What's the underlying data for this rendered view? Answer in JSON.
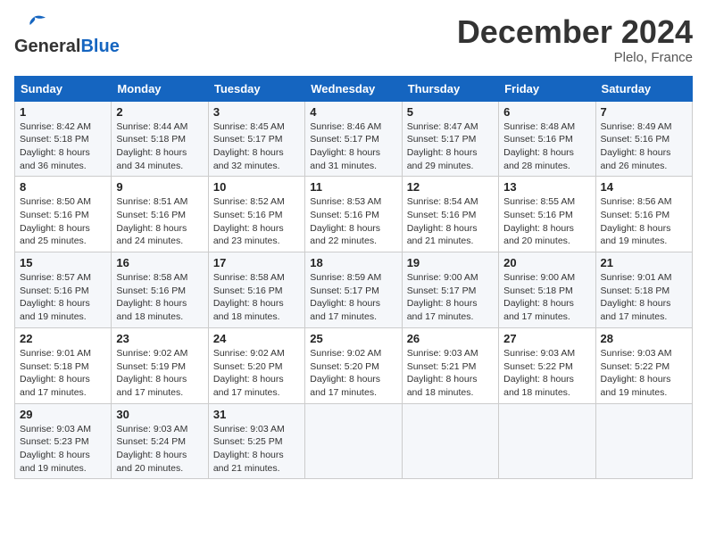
{
  "header": {
    "logo_general": "General",
    "logo_blue": "Blue",
    "month_title": "December 2024",
    "location": "Plelo, France"
  },
  "weekdays": [
    "Sunday",
    "Monday",
    "Tuesday",
    "Wednesday",
    "Thursday",
    "Friday",
    "Saturday"
  ],
  "weeks": [
    [
      {
        "day": "1",
        "sunrise": "8:42 AM",
        "sunset": "5:18 PM",
        "daylight": "8 hours and 36 minutes."
      },
      {
        "day": "2",
        "sunrise": "8:44 AM",
        "sunset": "5:18 PM",
        "daylight": "8 hours and 34 minutes."
      },
      {
        "day": "3",
        "sunrise": "8:45 AM",
        "sunset": "5:17 PM",
        "daylight": "8 hours and 32 minutes."
      },
      {
        "day": "4",
        "sunrise": "8:46 AM",
        "sunset": "5:17 PM",
        "daylight": "8 hours and 31 minutes."
      },
      {
        "day": "5",
        "sunrise": "8:47 AM",
        "sunset": "5:17 PM",
        "daylight": "8 hours and 29 minutes."
      },
      {
        "day": "6",
        "sunrise": "8:48 AM",
        "sunset": "5:16 PM",
        "daylight": "8 hours and 28 minutes."
      },
      {
        "day": "7",
        "sunrise": "8:49 AM",
        "sunset": "5:16 PM",
        "daylight": "8 hours and 26 minutes."
      }
    ],
    [
      {
        "day": "8",
        "sunrise": "8:50 AM",
        "sunset": "5:16 PM",
        "daylight": "8 hours and 25 minutes."
      },
      {
        "day": "9",
        "sunrise": "8:51 AM",
        "sunset": "5:16 PM",
        "daylight": "8 hours and 24 minutes."
      },
      {
        "day": "10",
        "sunrise": "8:52 AM",
        "sunset": "5:16 PM",
        "daylight": "8 hours and 23 minutes."
      },
      {
        "day": "11",
        "sunrise": "8:53 AM",
        "sunset": "5:16 PM",
        "daylight": "8 hours and 22 minutes."
      },
      {
        "day": "12",
        "sunrise": "8:54 AM",
        "sunset": "5:16 PM",
        "daylight": "8 hours and 21 minutes."
      },
      {
        "day": "13",
        "sunrise": "8:55 AM",
        "sunset": "5:16 PM",
        "daylight": "8 hours and 20 minutes."
      },
      {
        "day": "14",
        "sunrise": "8:56 AM",
        "sunset": "5:16 PM",
        "daylight": "8 hours and 19 minutes."
      }
    ],
    [
      {
        "day": "15",
        "sunrise": "8:57 AM",
        "sunset": "5:16 PM",
        "daylight": "8 hours and 19 minutes."
      },
      {
        "day": "16",
        "sunrise": "8:58 AM",
        "sunset": "5:16 PM",
        "daylight": "8 hours and 18 minutes."
      },
      {
        "day": "17",
        "sunrise": "8:58 AM",
        "sunset": "5:16 PM",
        "daylight": "8 hours and 18 minutes."
      },
      {
        "day": "18",
        "sunrise": "8:59 AM",
        "sunset": "5:17 PM",
        "daylight": "8 hours and 17 minutes."
      },
      {
        "day": "19",
        "sunrise": "9:00 AM",
        "sunset": "5:17 PM",
        "daylight": "8 hours and 17 minutes."
      },
      {
        "day": "20",
        "sunrise": "9:00 AM",
        "sunset": "5:18 PM",
        "daylight": "8 hours and 17 minutes."
      },
      {
        "day": "21",
        "sunrise": "9:01 AM",
        "sunset": "5:18 PM",
        "daylight": "8 hours and 17 minutes."
      }
    ],
    [
      {
        "day": "22",
        "sunrise": "9:01 AM",
        "sunset": "5:18 PM",
        "daylight": "8 hours and 17 minutes."
      },
      {
        "day": "23",
        "sunrise": "9:02 AM",
        "sunset": "5:19 PM",
        "daylight": "8 hours and 17 minutes."
      },
      {
        "day": "24",
        "sunrise": "9:02 AM",
        "sunset": "5:20 PM",
        "daylight": "8 hours and 17 minutes."
      },
      {
        "day": "25",
        "sunrise": "9:02 AM",
        "sunset": "5:20 PM",
        "daylight": "8 hours and 17 minutes."
      },
      {
        "day": "26",
        "sunrise": "9:03 AM",
        "sunset": "5:21 PM",
        "daylight": "8 hours and 18 minutes."
      },
      {
        "day": "27",
        "sunrise": "9:03 AM",
        "sunset": "5:22 PM",
        "daylight": "8 hours and 18 minutes."
      },
      {
        "day": "28",
        "sunrise": "9:03 AM",
        "sunset": "5:22 PM",
        "daylight": "8 hours and 19 minutes."
      }
    ],
    [
      {
        "day": "29",
        "sunrise": "9:03 AM",
        "sunset": "5:23 PM",
        "daylight": "8 hours and 19 minutes."
      },
      {
        "day": "30",
        "sunrise": "9:03 AM",
        "sunset": "5:24 PM",
        "daylight": "8 hours and 20 minutes."
      },
      {
        "day": "31",
        "sunrise": "9:03 AM",
        "sunset": "5:25 PM",
        "daylight": "8 hours and 21 minutes."
      },
      null,
      null,
      null,
      null
    ]
  ]
}
